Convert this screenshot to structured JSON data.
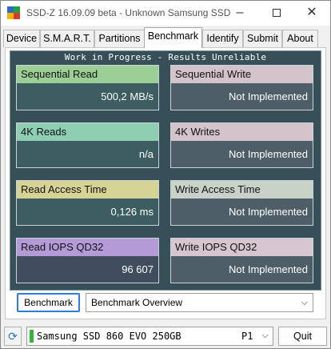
{
  "window": {
    "title": "SSD-Z 16.09.09 beta - Unknown Samsung SSD",
    "controls": {
      "minimize": "–",
      "close": "✕"
    }
  },
  "tabs": [
    {
      "label": "Device"
    },
    {
      "label": "S.M.A.R.T."
    },
    {
      "label": "Partitions"
    },
    {
      "label": "Benchmark",
      "active": true
    },
    {
      "label": "Identify"
    },
    {
      "label": "Submit"
    },
    {
      "label": "About"
    }
  ],
  "benchmark": {
    "banner": "Work in Progress - Results Unreliable",
    "results": [
      {
        "label": "Sequential Read",
        "value": "500,2 MB/s",
        "header_color": "#9ccf96"
      },
      {
        "label": "Sequential Write",
        "value": "Not Implemented",
        "header_color": "#d3c4cb"
      },
      {
        "label": "4K Reads",
        "value": "n/a",
        "header_color": "#8fcfb1"
      },
      {
        "label": "4K Writes",
        "value": "Not Implemented",
        "header_color": "#d3c4cb"
      },
      {
        "label": "Read Access Time",
        "value": "0,126 ms",
        "header_color": "#d6d495"
      },
      {
        "label": "Write Access Time",
        "value": "Not Implemented",
        "header_color": "#c9d2c6"
      },
      {
        "label": "Read IOPS QD32",
        "value": "96 607",
        "header_color": "#b39bd8"
      },
      {
        "label": "Write IOPS QD32",
        "value": "Not Implemented",
        "header_color": "#d6c6cf"
      }
    ],
    "run_button_label": "Benchmark",
    "view_select": {
      "value": "Benchmark Overview"
    }
  },
  "footer": {
    "refresh_icon": "refresh-icon",
    "drive_name": "Samsung SSD 860 EVO 250GB",
    "drive_port": "P1",
    "drive_status_color": "#33b339",
    "quit_label": "Quit"
  },
  "icons": {
    "chevron": "⌵",
    "refresh": "⟳"
  }
}
